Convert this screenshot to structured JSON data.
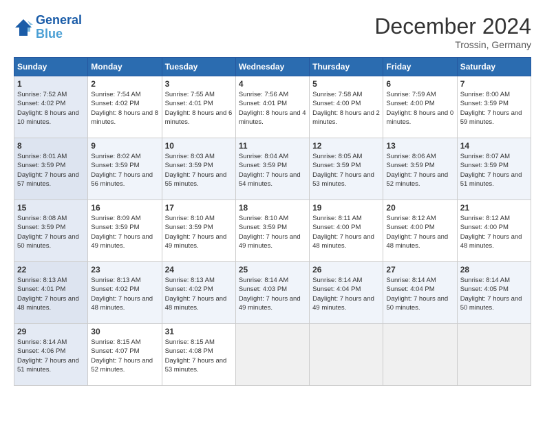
{
  "header": {
    "logo_line1": "General",
    "logo_line2": "Blue",
    "month": "December 2024",
    "location": "Trossin, Germany"
  },
  "days_of_week": [
    "Sunday",
    "Monday",
    "Tuesday",
    "Wednesday",
    "Thursday",
    "Friday",
    "Saturday"
  ],
  "weeks": [
    [
      {
        "day": "1",
        "sunrise": "7:52 AM",
        "sunset": "4:02 PM",
        "daylight": "8 hours and 10 minutes."
      },
      {
        "day": "2",
        "sunrise": "7:54 AM",
        "sunset": "4:02 PM",
        "daylight": "8 hours and 8 minutes."
      },
      {
        "day": "3",
        "sunrise": "7:55 AM",
        "sunset": "4:01 PM",
        "daylight": "8 hours and 6 minutes."
      },
      {
        "day": "4",
        "sunrise": "7:56 AM",
        "sunset": "4:01 PM",
        "daylight": "8 hours and 4 minutes."
      },
      {
        "day": "5",
        "sunrise": "7:58 AM",
        "sunset": "4:00 PM",
        "daylight": "8 hours and 2 minutes."
      },
      {
        "day": "6",
        "sunrise": "7:59 AM",
        "sunset": "4:00 PM",
        "daylight": "8 hours and 0 minutes."
      },
      {
        "day": "7",
        "sunrise": "8:00 AM",
        "sunset": "3:59 PM",
        "daylight": "7 hours and 59 minutes."
      }
    ],
    [
      {
        "day": "8",
        "sunrise": "8:01 AM",
        "sunset": "3:59 PM",
        "daylight": "7 hours and 57 minutes."
      },
      {
        "day": "9",
        "sunrise": "8:02 AM",
        "sunset": "3:59 PM",
        "daylight": "7 hours and 56 minutes."
      },
      {
        "day": "10",
        "sunrise": "8:03 AM",
        "sunset": "3:59 PM",
        "daylight": "7 hours and 55 minutes."
      },
      {
        "day": "11",
        "sunrise": "8:04 AM",
        "sunset": "3:59 PM",
        "daylight": "7 hours and 54 minutes."
      },
      {
        "day": "12",
        "sunrise": "8:05 AM",
        "sunset": "3:59 PM",
        "daylight": "7 hours and 53 minutes."
      },
      {
        "day": "13",
        "sunrise": "8:06 AM",
        "sunset": "3:59 PM",
        "daylight": "7 hours and 52 minutes."
      },
      {
        "day": "14",
        "sunrise": "8:07 AM",
        "sunset": "3:59 PM",
        "daylight": "7 hours and 51 minutes."
      }
    ],
    [
      {
        "day": "15",
        "sunrise": "8:08 AM",
        "sunset": "3:59 PM",
        "daylight": "7 hours and 50 minutes."
      },
      {
        "day": "16",
        "sunrise": "8:09 AM",
        "sunset": "3:59 PM",
        "daylight": "7 hours and 49 minutes."
      },
      {
        "day": "17",
        "sunrise": "8:10 AM",
        "sunset": "3:59 PM",
        "daylight": "7 hours and 49 minutes."
      },
      {
        "day": "18",
        "sunrise": "8:10 AM",
        "sunset": "3:59 PM",
        "daylight": "7 hours and 49 minutes."
      },
      {
        "day": "19",
        "sunrise": "8:11 AM",
        "sunset": "4:00 PM",
        "daylight": "7 hours and 48 minutes."
      },
      {
        "day": "20",
        "sunrise": "8:12 AM",
        "sunset": "4:00 PM",
        "daylight": "7 hours and 48 minutes."
      },
      {
        "day": "21",
        "sunrise": "8:12 AM",
        "sunset": "4:00 PM",
        "daylight": "7 hours and 48 minutes."
      }
    ],
    [
      {
        "day": "22",
        "sunrise": "8:13 AM",
        "sunset": "4:01 PM",
        "daylight": "7 hours and 48 minutes."
      },
      {
        "day": "23",
        "sunrise": "8:13 AM",
        "sunset": "4:02 PM",
        "daylight": "7 hours and 48 minutes."
      },
      {
        "day": "24",
        "sunrise": "8:13 AM",
        "sunset": "4:02 PM",
        "daylight": "7 hours and 48 minutes."
      },
      {
        "day": "25",
        "sunrise": "8:14 AM",
        "sunset": "4:03 PM",
        "daylight": "7 hours and 49 minutes."
      },
      {
        "day": "26",
        "sunrise": "8:14 AM",
        "sunset": "4:04 PM",
        "daylight": "7 hours and 49 minutes."
      },
      {
        "day": "27",
        "sunrise": "8:14 AM",
        "sunset": "4:04 PM",
        "daylight": "7 hours and 50 minutes."
      },
      {
        "day": "28",
        "sunrise": "8:14 AM",
        "sunset": "4:05 PM",
        "daylight": "7 hours and 50 minutes."
      }
    ],
    [
      {
        "day": "29",
        "sunrise": "8:14 AM",
        "sunset": "4:06 PM",
        "daylight": "7 hours and 51 minutes."
      },
      {
        "day": "30",
        "sunrise": "8:15 AM",
        "sunset": "4:07 PM",
        "daylight": "7 hours and 52 minutes."
      },
      {
        "day": "31",
        "sunrise": "8:15 AM",
        "sunset": "4:08 PM",
        "daylight": "7 hours and 53 minutes."
      },
      null,
      null,
      null,
      null
    ]
  ]
}
